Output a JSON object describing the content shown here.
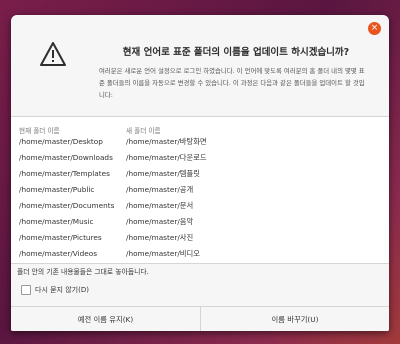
{
  "dialog": {
    "close_label": "×",
    "title": "현재 언어로 표준 폴더의 이름을 업데이트 하시겠습니까?",
    "description": "여러분은 새로운 언어 설정으로 로그인 하였습니다. 이 언어에 맞도록 여러분의 홈 폴더 내의 몇몇 표준 폴더들의 이름을 자동으로 변경할 수 있습니다. 이 과정은 다음과 같은 폴더들을 업데이트 할 것입니다:",
    "columns": {
      "current": "현재 폴더 이름",
      "new": "새 폴더 이름"
    },
    "rows": [
      {
        "current": "/home/master/Desktop",
        "new": "/home/master/바탕화면"
      },
      {
        "current": "/home/master/Downloads",
        "new": "/home/master/다운로드"
      },
      {
        "current": "/home/master/Templates",
        "new": "/home/master/템플릿"
      },
      {
        "current": "/home/master/Public",
        "new": "/home/master/공개"
      },
      {
        "current": "/home/master/Documents",
        "new": "/home/master/문서"
      },
      {
        "current": "/home/master/Music",
        "new": "/home/master/음악"
      },
      {
        "current": "/home/master/Pictures",
        "new": "/home/master/사진"
      },
      {
        "current": "/home/master/Videos",
        "new": "/home/master/비디오"
      }
    ],
    "note": "폴더 안의 기존 내용물들은 그대로 놓아둡니다.",
    "dont_ask_label": "다시 묻지 않기(D)",
    "dont_ask_checked": false,
    "keep_button": "예전 이름 유지(K)",
    "change_button": "이름 바꾸기(U)"
  },
  "colors": {
    "accent": "#e95420",
    "warning_icon": "#2e2e2e"
  }
}
